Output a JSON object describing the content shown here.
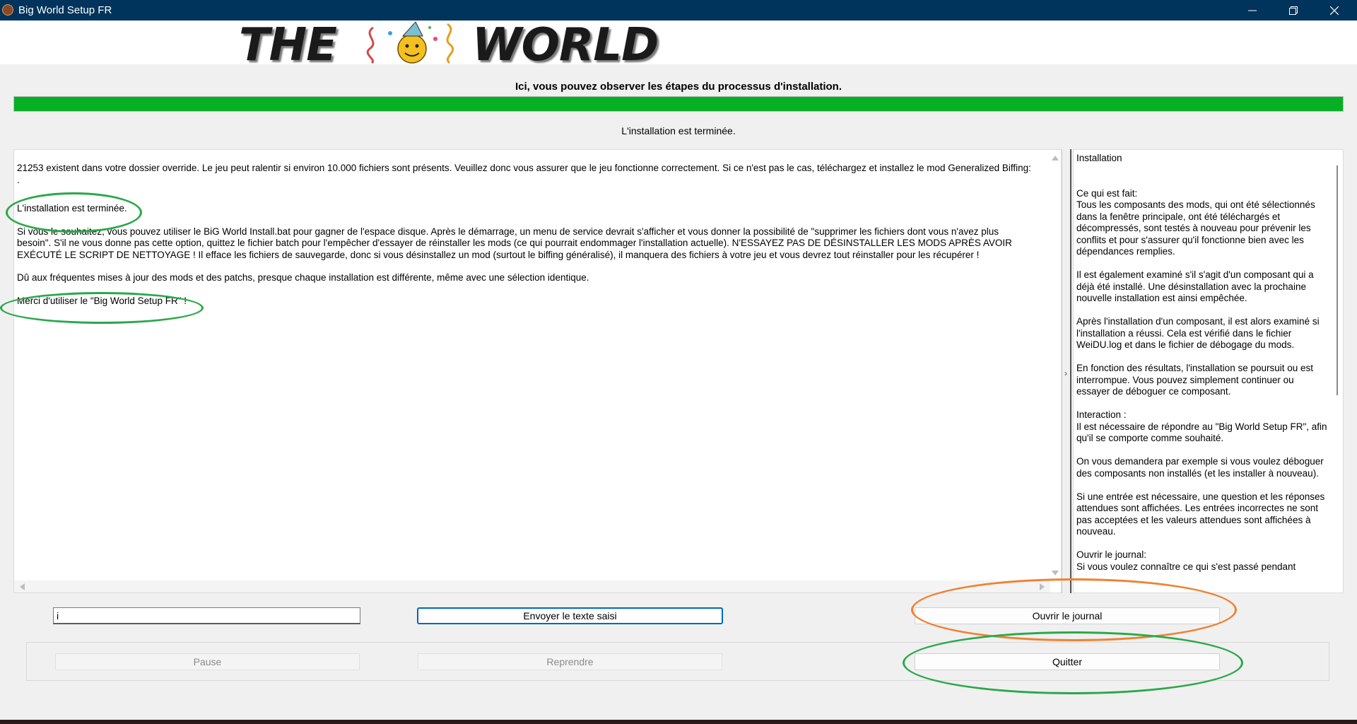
{
  "window": {
    "title": "Big World Setup FR",
    "icons": [
      "app-icon",
      "minimize-icon",
      "restore-icon",
      "close-icon"
    ]
  },
  "banner": {
    "left_word": "THE",
    "right_word": "WORLD"
  },
  "instruction": "Ici, vous pouvez observer les étapes du processus d'installation.",
  "progress": {
    "percent": 100,
    "color": "#06b025"
  },
  "status": "L'installation est terminée.",
  "log": {
    "lines": [
      "21253 existent dans votre dossier override. Le jeu peut ralentir si environ 10.000 fichiers sont présents. Veuillez donc vous assurer que le jeu fonctionne correctement. Si ce n'est pas le cas, téléchargez et installez le mod Generalized Biffing:\n.",
      "L'installation est terminée.",
      "Si vous le souhaitez, vous pouvez utiliser le BiG World Install.bat pour gagner de l'espace disque. Après le démarrage, un menu de service devrait s'afficher et vous donner la possibilité de \"supprimer les fichiers dont vous n'avez plus besoin\". S'il ne vous donne pas cette option, quittez le fichier batch pour l'empêcher d'essayer de réinstaller les mods (ce qui pourrait endommager l'installation actuelle). N'ESSAYEZ PAS DE DÉSINSTALLER LES MODS APRÈS AVOIR EXÉCUTÉ LE SCRIPT DE NETTOYAGE ! Il efface les fichiers de sauvegarde, donc si vous désinstallez un mod (surtout le biffing généralisé), il manquera des fichiers à votre jeu et vous devrez tout réinstaller pour les récupérer !",
      "Dû aux fréquentes mises à jour des mods et des patchs, presque chaque installation est différente, même avec une sélection identique.",
      "Merci d'utiliser le \"Big World Setup FR\" !"
    ]
  },
  "help": {
    "paragraphs": [
      "Installation",
      "Ce qui est fait:\nTous les composants des mods, qui ont été sélectionnés dans la fenêtre principale, ont été téléchargés et décompressés, sont testés à nouveau pour prévenir les conflits et pour s'assurer qu'il fonctionne bien avec les dépendances remplies.",
      "Il est également examiné s'il s'agit d'un composant qui a déjà été installé. Une désinstallation avec la prochaine nouvelle installation est ainsi empêchée.",
      "Après l'installation d'un composant, il est alors examiné si l'installation a réussi. Cela est vérifié dans le fichier WeiDU.log et dans le fichier de débogage du mods.",
      " En fonction des résultats, l'installation se poursuit ou est interrompue. Vous pouvez simplement continuer ou essayer de déboguer ce composant.",
      "Interaction :\nIl est nécessaire de répondre au \"Big World Setup FR\", afin qu'il se comporte comme souhaité.",
      " On vous demandera par exemple si vous voulez déboguer des composants non installés (et les installer à nouveau).",
      " Si une entrée est nécessaire, une question et les réponses attendues sont affichées. Les entrées incorrectes ne sont pas acceptées et les valeurs attendues sont affichées à nouveau.",
      "Ouvrir le journal:\nSi vous voulez connaître ce qui s'est passé pendant"
    ]
  },
  "input": {
    "value": "i"
  },
  "buttons": {
    "send": "Envoyer le texte saisi",
    "open_log": "Ouvrir le journal",
    "pause": "Pause",
    "resume": "Reprendre",
    "quit": "Quitter"
  },
  "colors": {
    "titlebar": "#00345c",
    "highlight_green": "#2aa84a",
    "highlight_orange": "#f08030"
  }
}
